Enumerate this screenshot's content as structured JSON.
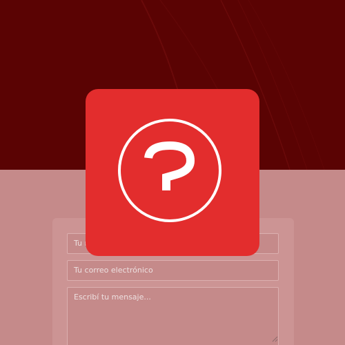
{
  "colors": {
    "hero_background": "#5a0303",
    "overlay_background": "#c58a8a",
    "tile_background": "#e32d2d",
    "tile_icon": "#ffffff"
  },
  "overlay_icon": "question-mark-circle-icon",
  "form": {
    "name_placeholder": "Tu n",
    "email_placeholder": "Tu correo electrónico",
    "message_placeholder": "Escribí tu mensaje..."
  }
}
